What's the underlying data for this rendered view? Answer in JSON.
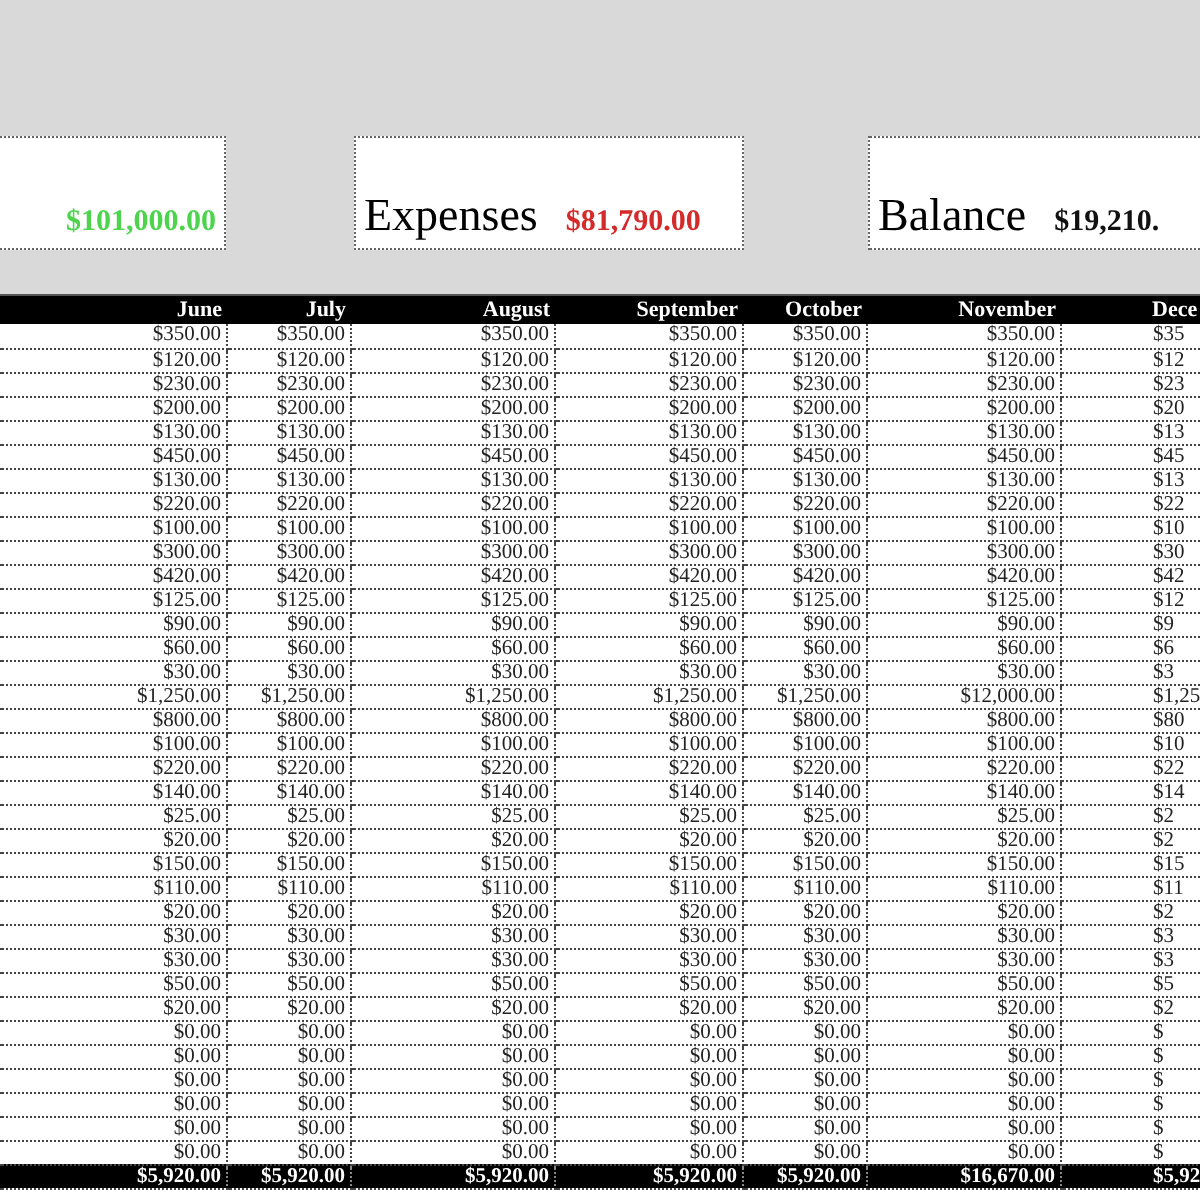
{
  "summary_cards": [
    {
      "kind": "income",
      "value": "$101,000.00"
    },
    {
      "kind": "expenses",
      "label": "Expenses",
      "value": "$81,790.00"
    },
    {
      "kind": "balance",
      "label": "Balance",
      "value": "$19,210."
    }
  ],
  "table": {
    "columns": [
      "June",
      "July",
      "August",
      "September",
      "October",
      "November",
      "Dece"
    ],
    "rows": [
      [
        "$350.00",
        "$350.00",
        "$350.00",
        "$350.00",
        "$350.00",
        "$350.00",
        "$35"
      ],
      [
        "$120.00",
        "$120.00",
        "$120.00",
        "$120.00",
        "$120.00",
        "$120.00",
        "$12"
      ],
      [
        "$230.00",
        "$230.00",
        "$230.00",
        "$230.00",
        "$230.00",
        "$230.00",
        "$23"
      ],
      [
        "$200.00",
        "$200.00",
        "$200.00",
        "$200.00",
        "$200.00",
        "$200.00",
        "$20"
      ],
      [
        "$130.00",
        "$130.00",
        "$130.00",
        "$130.00",
        "$130.00",
        "$130.00",
        "$13"
      ],
      [
        "$450.00",
        "$450.00",
        "$450.00",
        "$450.00",
        "$450.00",
        "$450.00",
        "$45"
      ],
      [
        "$130.00",
        "$130.00",
        "$130.00",
        "$130.00",
        "$130.00",
        "$130.00",
        "$13"
      ],
      [
        "$220.00",
        "$220.00",
        "$220.00",
        "$220.00",
        "$220.00",
        "$220.00",
        "$22"
      ],
      [
        "$100.00",
        "$100.00",
        "$100.00",
        "$100.00",
        "$100.00",
        "$100.00",
        "$10"
      ],
      [
        "$300.00",
        "$300.00",
        "$300.00",
        "$300.00",
        "$300.00",
        "$300.00",
        "$30"
      ],
      [
        "$420.00",
        "$420.00",
        "$420.00",
        "$420.00",
        "$420.00",
        "$420.00",
        "$42"
      ],
      [
        "$125.00",
        "$125.00",
        "$125.00",
        "$125.00",
        "$125.00",
        "$125.00",
        "$12"
      ],
      [
        "$90.00",
        "$90.00",
        "$90.00",
        "$90.00",
        "$90.00",
        "$90.00",
        "$9"
      ],
      [
        "$60.00",
        "$60.00",
        "$60.00",
        "$60.00",
        "$60.00",
        "$60.00",
        "$6"
      ],
      [
        "$30.00",
        "$30.00",
        "$30.00",
        "$30.00",
        "$30.00",
        "$30.00",
        "$3"
      ],
      [
        "$1,250.00",
        "$1,250.00",
        "$1,250.00",
        "$1,250.00",
        "$1,250.00",
        "$12,000.00",
        "$1,25"
      ],
      [
        "$800.00",
        "$800.00",
        "$800.00",
        "$800.00",
        "$800.00",
        "$800.00",
        "$80"
      ],
      [
        "$100.00",
        "$100.00",
        "$100.00",
        "$100.00",
        "$100.00",
        "$100.00",
        "$10"
      ],
      [
        "$220.00",
        "$220.00",
        "$220.00",
        "$220.00",
        "$220.00",
        "$220.00",
        "$22"
      ],
      [
        "$140.00",
        "$140.00",
        "$140.00",
        "$140.00",
        "$140.00",
        "$140.00",
        "$14"
      ],
      [
        "$25.00",
        "$25.00",
        "$25.00",
        "$25.00",
        "$25.00",
        "$25.00",
        "$2"
      ],
      [
        "$20.00",
        "$20.00",
        "$20.00",
        "$20.00",
        "$20.00",
        "$20.00",
        "$2"
      ],
      [
        "$150.00",
        "$150.00",
        "$150.00",
        "$150.00",
        "$150.00",
        "$150.00",
        "$15"
      ],
      [
        "$110.00",
        "$110.00",
        "$110.00",
        "$110.00",
        "$110.00",
        "$110.00",
        "$11"
      ],
      [
        "$20.00",
        "$20.00",
        "$20.00",
        "$20.00",
        "$20.00",
        "$20.00",
        "$2"
      ],
      [
        "$30.00",
        "$30.00",
        "$30.00",
        "$30.00",
        "$30.00",
        "$30.00",
        "$3"
      ],
      [
        "$30.00",
        "$30.00",
        "$30.00",
        "$30.00",
        "$30.00",
        "$30.00",
        "$3"
      ],
      [
        "$50.00",
        "$50.00",
        "$50.00",
        "$50.00",
        "$50.00",
        "$50.00",
        "$5"
      ],
      [
        "$20.00",
        "$20.00",
        "$20.00",
        "$20.00",
        "$20.00",
        "$20.00",
        "$2"
      ],
      [
        "$0.00",
        "$0.00",
        "$0.00",
        "$0.00",
        "$0.00",
        "$0.00",
        "$"
      ],
      [
        "$0.00",
        "$0.00",
        "$0.00",
        "$0.00",
        "$0.00",
        "$0.00",
        "$"
      ],
      [
        "$0.00",
        "$0.00",
        "$0.00",
        "$0.00",
        "$0.00",
        "$0.00",
        "$"
      ],
      [
        "$0.00",
        "$0.00",
        "$0.00",
        "$0.00",
        "$0.00",
        "$0.00",
        "$"
      ],
      [
        "$0.00",
        "$0.00",
        "$0.00",
        "$0.00",
        "$0.00",
        "$0.00",
        "$"
      ],
      [
        "$0.00",
        "$0.00",
        "$0.00",
        "$0.00",
        "$0.00",
        "$0.00",
        "$"
      ]
    ],
    "totals": [
      "$5,920.00",
      "$5,920.00",
      "$5,920.00",
      "$5,920.00",
      "$5,920.00",
      "$16,670.00",
      "$5,92"
    ]
  }
}
